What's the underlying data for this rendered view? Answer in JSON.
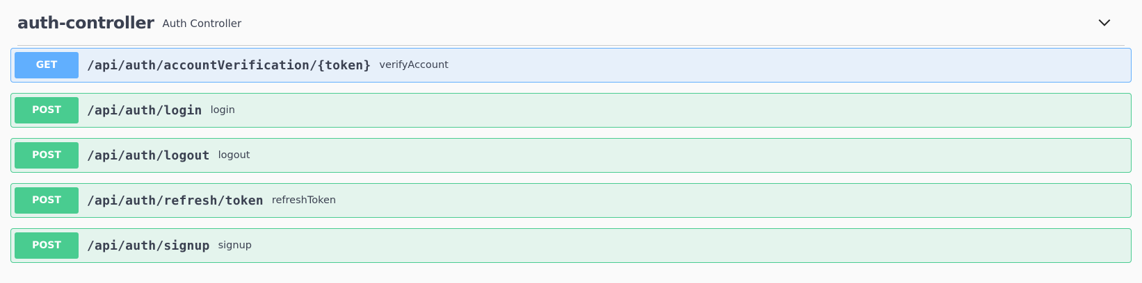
{
  "tag": {
    "name": "auth-controller",
    "description": "Auth Controller"
  },
  "operations": [
    {
      "method": "GET",
      "path": "/api/auth/accountVerification/{token}",
      "summary": "verifyAccount"
    },
    {
      "method": "POST",
      "path": "/api/auth/login",
      "summary": "login"
    },
    {
      "method": "POST",
      "path": "/api/auth/logout",
      "summary": "logout"
    },
    {
      "method": "POST",
      "path": "/api/auth/refresh/token",
      "summary": "refreshToken"
    },
    {
      "method": "POST",
      "path": "/api/auth/signup",
      "summary": "signup"
    }
  ],
  "colors": {
    "get": "#61affe",
    "post": "#49cc90",
    "text": "#3b4151"
  },
  "icons": {
    "collapse": "chevron-down-icon"
  }
}
